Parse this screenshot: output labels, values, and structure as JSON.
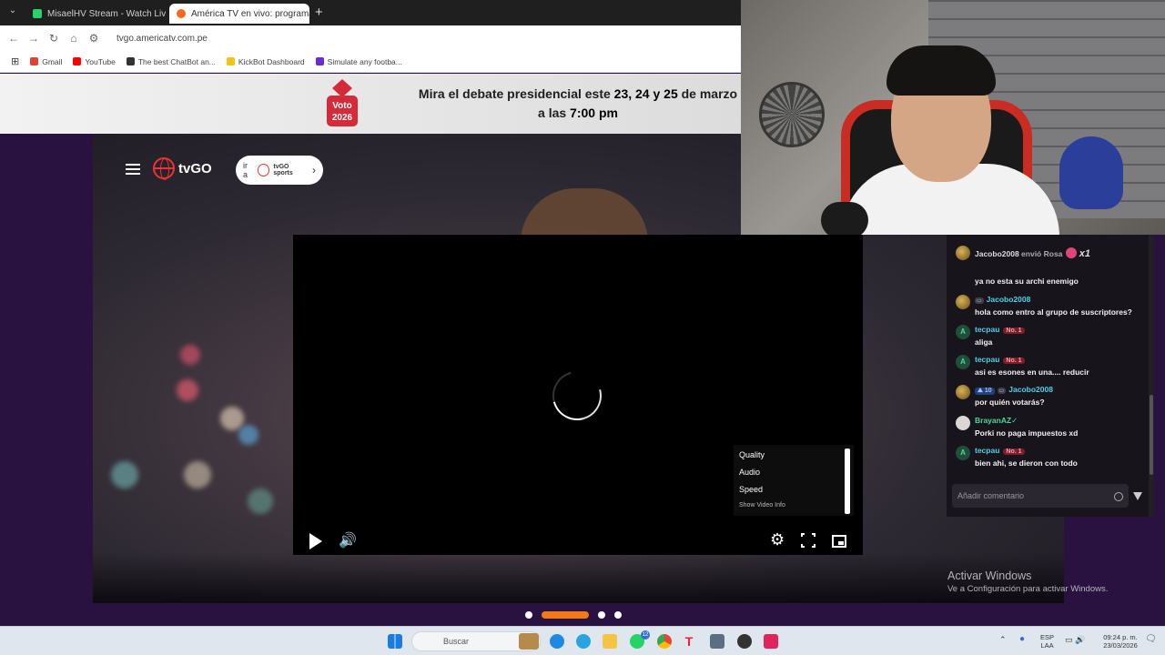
{
  "browser": {
    "tabs": [
      {
        "title": "MisaelHV Stream - Watch Live",
        "color": "#2bd16a"
      },
      {
        "title": "América TV en vivo: programac",
        "color": "#f36b1c"
      }
    ],
    "new_tab": "+",
    "url": "tvgo.americatv.com.pe",
    "bookmarks": [
      {
        "label": "Gmail",
        "color": "#e34133"
      },
      {
        "label": "YouTube",
        "color": "#ff0000"
      },
      {
        "label": "The best ChatBot an...",
        "color": "#333333"
      },
      {
        "label": "KickBot Dashboard",
        "color": "#f0c419"
      },
      {
        "label": "Simulate any footba...",
        "color": "#6c2bd9"
      }
    ]
  },
  "banner": {
    "logo_text": "Voto 2026",
    "line1_prefix": "Mira el debate presidencial este ",
    "line1_dates": "23, 24 y 25",
    "line1_suffix": " de marzo",
    "line2_prefix": "a las ",
    "line2_time": "7:00 pm"
  },
  "header": {
    "logo": "tvGO",
    "ira_prefix": "ir a",
    "ira_brand": "tvGO sports"
  },
  "player": {
    "settings_menu": [
      "Quality",
      "Audio",
      "Speed"
    ],
    "show_info": "Show Video Info"
  },
  "carousel": {
    "active_index": 1,
    "count": 4
  },
  "chat": {
    "gift": {
      "user": "Jacobo2008",
      "action": "envió Rosa",
      "count": "x1"
    },
    "messages": [
      {
        "user": "",
        "text": "ya no esta su archi enemigo",
        "avatar": "none"
      },
      {
        "user": "Jacobo2008",
        "text": "hola como entro al grupo de suscriptores?",
        "avatar": "gold",
        "badges": [
          "sub"
        ]
      },
      {
        "user": "tecpau",
        "text": "aliga",
        "avatar": "A",
        "badges": [
          "No. 1"
        ]
      },
      {
        "user": "tecpau",
        "text": "asi es esones en una.... reducir",
        "avatar": "A",
        "badges": [
          "No. 1"
        ]
      },
      {
        "user": "Jacobo2008",
        "text": "por quién votarás?",
        "avatar": "gold",
        "badges": [
          "10",
          "sub"
        ]
      },
      {
        "user": "BrayanAZ✓",
        "text": "Porki no paga impuestos xd",
        "avatar": "grey"
      },
      {
        "user": "tecpau",
        "text": "bien ahi, se dieron con todo",
        "avatar": "A",
        "badges": [
          "No. 1"
        ]
      }
    ],
    "input_placeholder": "Añadir comentario"
  },
  "watermark": {
    "title": "Activar Windows",
    "subtitle": "Ve a Configuración para activar Windows."
  },
  "taskbar": {
    "search_placeholder": "Buscar",
    "lang_top": "ESP",
    "lang_bottom": "LAA",
    "time": "09:24 p. m.",
    "date": "23/03/2026",
    "whatsapp_badge": "12"
  }
}
